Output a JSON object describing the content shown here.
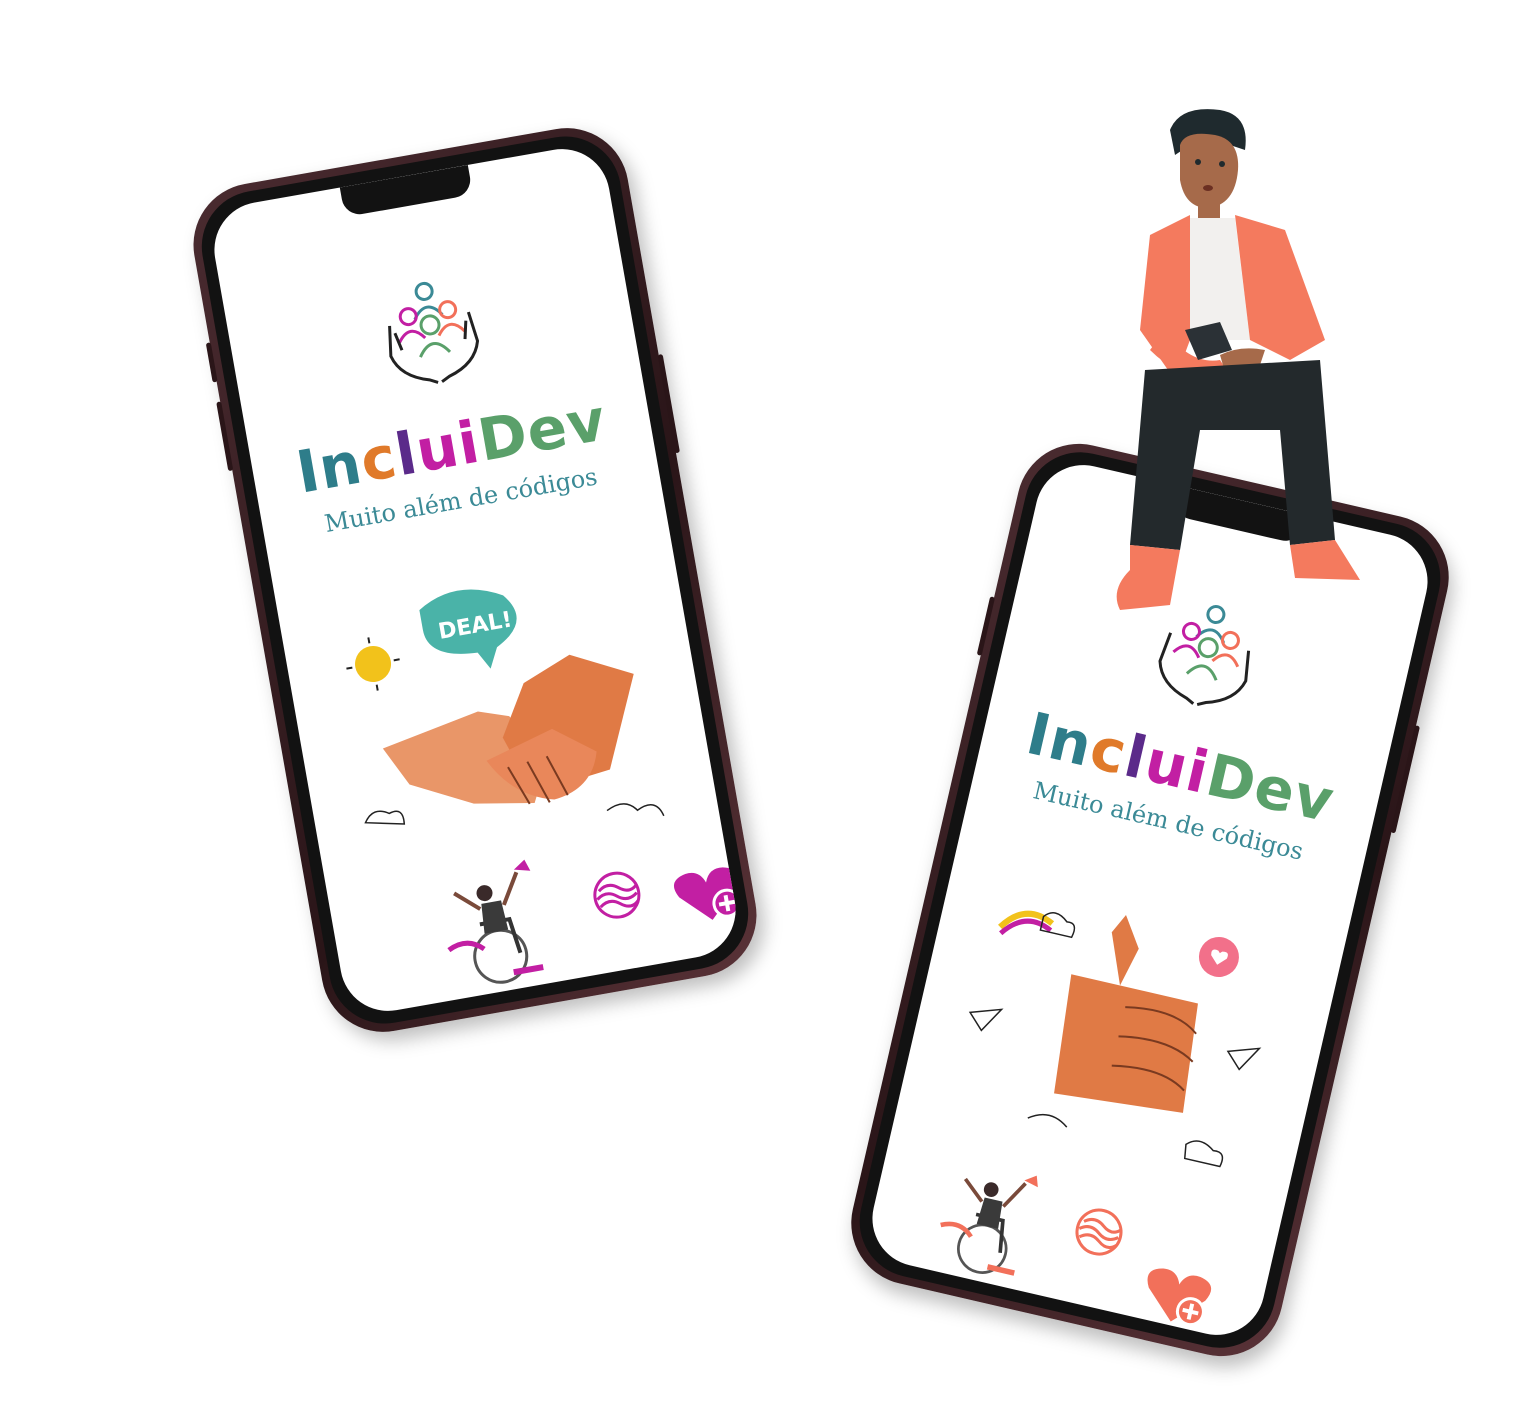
{
  "phones": [
    {
      "brand": {
        "p1": "I",
        "p2": "n",
        "p3": "c",
        "p4": "l",
        "p5": "u",
        "p6": "i",
        "p7": "Dev"
      },
      "tagline": "Muito além de códigos",
      "speech_bubble": "DEAL!",
      "heart_color": "#c21fa3"
    },
    {
      "brand": {
        "p1": "I",
        "p2": "n",
        "p3": "c",
        "p4": "l",
        "p5": "u",
        "p6": "i",
        "p7": "Dev"
      },
      "tagline": "Muito além de códigos",
      "heart_color": "#f2705a"
    }
  ],
  "colors": {
    "accent_magenta": "#c21fa3",
    "accent_teal": "#3b8a96",
    "accent_green": "#5aa06a",
    "hand_orange": "#e07a45",
    "jacket": "#f47a5e"
  }
}
